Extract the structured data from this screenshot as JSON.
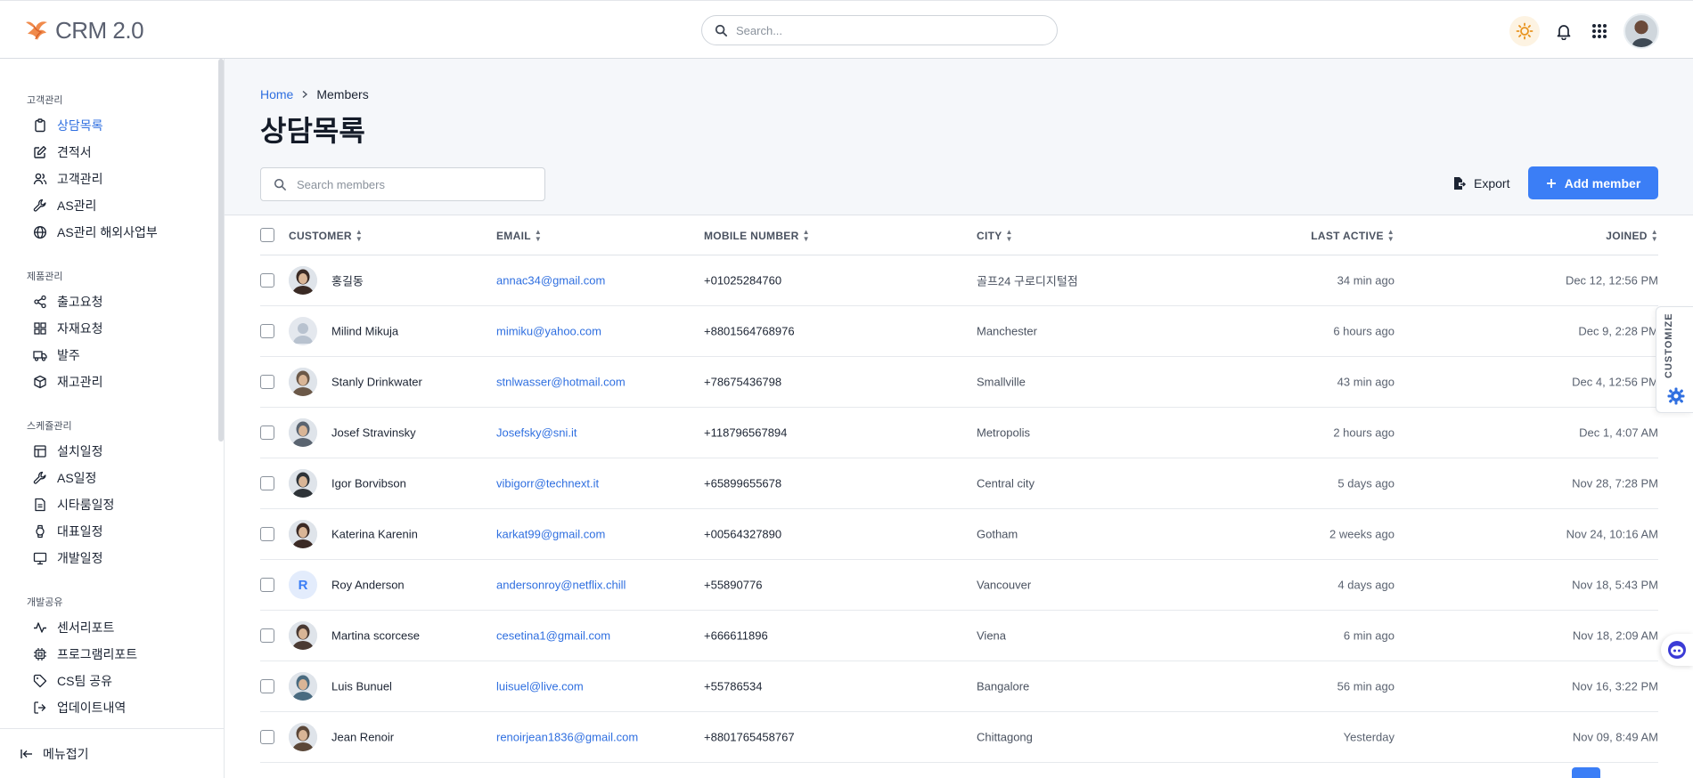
{
  "app": {
    "title": "CRM 2.0"
  },
  "header": {
    "search_placeholder": "Search..."
  },
  "sidebar": {
    "sections": [
      {
        "label": "고객관리",
        "items": [
          {
            "label": "상담목록",
            "icon": "clipboard-icon",
            "active": true
          },
          {
            "label": "견적서",
            "icon": "edit-icon"
          },
          {
            "label": "고객관리",
            "icon": "users-icon"
          },
          {
            "label": "AS관리",
            "icon": "wrench-icon"
          },
          {
            "label": "AS관리 해외사업부",
            "icon": "globe-icon"
          }
        ]
      },
      {
        "label": "제품관리",
        "items": [
          {
            "label": "출고요청",
            "icon": "share-icon"
          },
          {
            "label": "자재요청",
            "icon": "grid-icon"
          },
          {
            "label": "발주",
            "icon": "truck-icon"
          },
          {
            "label": "재고관리",
            "icon": "box-icon"
          }
        ]
      },
      {
        "label": "스케쥴관리",
        "items": [
          {
            "label": "설치일정",
            "icon": "table-icon"
          },
          {
            "label": "AS일정",
            "icon": "wrench-icon"
          },
          {
            "label": "시타룸일정",
            "icon": "document-icon"
          },
          {
            "label": "대표일정",
            "icon": "watch-icon"
          },
          {
            "label": "개발일정",
            "icon": "monitor-icon"
          }
        ]
      },
      {
        "label": "개발공유",
        "items": [
          {
            "label": "센서리포트",
            "icon": "activity-icon"
          },
          {
            "label": "프로그램리포트",
            "icon": "cpu-icon"
          },
          {
            "label": "CS팀 공유",
            "icon": "tag-icon"
          },
          {
            "label": "업데이트내역",
            "icon": "logout-icon"
          }
        ]
      }
    ],
    "collapse_label": "메뉴접기"
  },
  "main": {
    "breadcrumb": {
      "home": "Home",
      "current": "Members"
    },
    "title": "상담목록",
    "search_placeholder": "Search members",
    "export_label": "Export",
    "add_label": "Add member"
  },
  "table": {
    "columns": {
      "customer": "CUSTOMER",
      "email": "EMAIL",
      "mobile": "MOBILE NUMBER",
      "city": "CITY",
      "last_active": "LAST ACTIVE",
      "joined": "JOINED"
    },
    "rows": [
      {
        "name": "홍길동",
        "email": "annac34@gmail.com",
        "mobile": "+01025284760",
        "city": "골프24 구로디지털점",
        "last_active": "34 min ago",
        "joined": "Dec 12, 12:56 PM",
        "avatar": "photo",
        "avatar_color": "#3a2a24"
      },
      {
        "name": "Milind Mikuja",
        "email": "mimiku@yahoo.com",
        "mobile": "+8801564768976",
        "city": "Manchester",
        "last_active": "6 hours ago",
        "joined": "Dec 9, 2:28 PM",
        "avatar": "placeholder",
        "avatar_color": "#b8c2cf"
      },
      {
        "name": "Stanly Drinkwater",
        "email": "stnlwasser@hotmail.com",
        "mobile": "+78675436798",
        "city": "Smallville",
        "last_active": "43 min ago",
        "joined": "Dec 4, 12:56 PM",
        "avatar": "photo",
        "avatar_color": "#6b5848"
      },
      {
        "name": "Josef Stravinsky",
        "email": "Josefsky@sni.it",
        "mobile": "+118796567894",
        "city": "Metropolis",
        "last_active": "2 hours ago",
        "joined": "Dec 1, 4:07 AM",
        "avatar": "photo",
        "avatar_color": "#5a6470"
      },
      {
        "name": "Igor Borvibson",
        "email": "vibigorr@technext.it",
        "mobile": "+65899655678",
        "city": "Central city",
        "last_active": "5 days ago",
        "joined": "Nov 28, 7:28 PM",
        "avatar": "photo",
        "avatar_color": "#2e3338"
      },
      {
        "name": "Katerina Karenin",
        "email": "karkat99@gmail.com",
        "mobile": "+00564327890",
        "city": "Gotham",
        "last_active": "2 weeks ago",
        "joined": "Nov 24, 10:16 AM",
        "avatar": "photo",
        "avatar_color": "#3b2a25"
      },
      {
        "name": "Roy Anderson",
        "email": "andersonroy@netflix.chill",
        "mobile": "+55890776",
        "city": "Vancouver",
        "last_active": "4 days ago",
        "joined": "Nov 18, 5:43 PM",
        "avatar": "initial",
        "initial": "R",
        "avatar_color": "#e3ecfc"
      },
      {
        "name": "Martina scorcese",
        "email": "cesetina1@gmail.com",
        "mobile": "+666611896",
        "city": "Viena",
        "last_active": "6 min ago",
        "joined": "Nov 18, 2:09 AM",
        "avatar": "photo",
        "avatar_color": "#4a3a33"
      },
      {
        "name": "Luis Bunuel",
        "email": "luisuel@live.com",
        "mobile": "+55786534",
        "city": "Bangalore",
        "last_active": "56 min ago",
        "joined": "Nov 16, 3:22 PM",
        "avatar": "photo",
        "avatar_color": "#4a6b80"
      },
      {
        "name": "Jean Renoir",
        "email": "renoirjean1836@gmail.com",
        "mobile": "+8801765458767",
        "city": "Chittagong",
        "last_active": "Yesterday",
        "joined": "Nov 09, 8:49 AM",
        "avatar": "photo",
        "avatar_color": "#5b4738"
      }
    ]
  },
  "customize": {
    "label": "CUSTOMIZE"
  },
  "colors": {
    "accent": "#3b7ef6",
    "link": "#2f6fe0",
    "logo": "#f08a4b"
  }
}
